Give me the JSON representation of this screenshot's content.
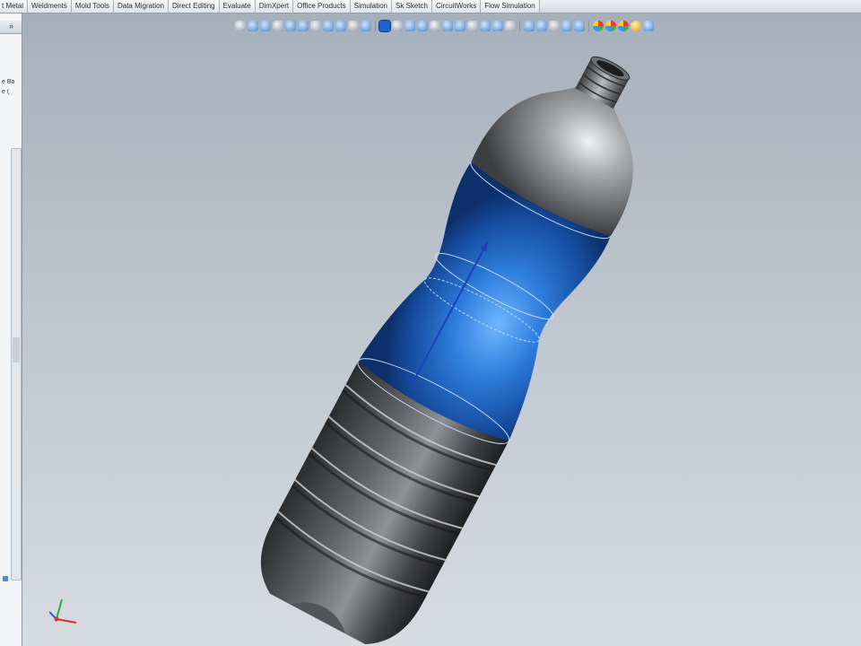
{
  "command_manager": {
    "tabs": [
      "t Metal",
      "Weldments",
      "Mold Tools",
      "Data Migration",
      "Direct Editing",
      "Evaluate",
      "DimXpert",
      "Office Products",
      "Simulation",
      "Sk Sketch",
      "CircuitWorks",
      "Flow Simulation"
    ]
  },
  "feature_manager": {
    "collapse_arrow": "»",
    "visible_lines": [
      "e Bo",
      "e ("
    ]
  },
  "heads_up_toolbar": {
    "icons": [
      "zoom-to-fit-icon",
      "zoom-to-area-icon",
      "previous-view-icon",
      "section-view-icon",
      "dynamic-annotation-icon",
      "view-orientation-icon",
      "display-style-icon",
      "hide-show-items-icon",
      "edit-appearance-icon",
      "apply-scene-icon",
      "view-settings-icon",
      "shaded-icon",
      "rotate-view-icon",
      "pan-icon",
      "roll-view-icon",
      "front-view-icon",
      "top-view-icon",
      "isometric-view-icon",
      "normal-to-icon",
      "perspective-icon",
      "shadows-icon",
      "realview-icon",
      "hidden-lines-icon",
      "wireframe-icon",
      "shaded-with-edges-icon",
      "curvature-icon",
      "zebra-stripes-icon",
      "appearance-palette-icon",
      "scene-sphere-icon",
      "decals-icon",
      "lighting-icon",
      "help-icon"
    ]
  },
  "colors": {
    "viewport_top": "#a6b0bb",
    "viewport_bottom": "#d7dce1",
    "bottle_grey": "#5b5d60",
    "bottle_highlight_blue": "#2f7fe0",
    "toolbar_active": "#1c62c8"
  }
}
